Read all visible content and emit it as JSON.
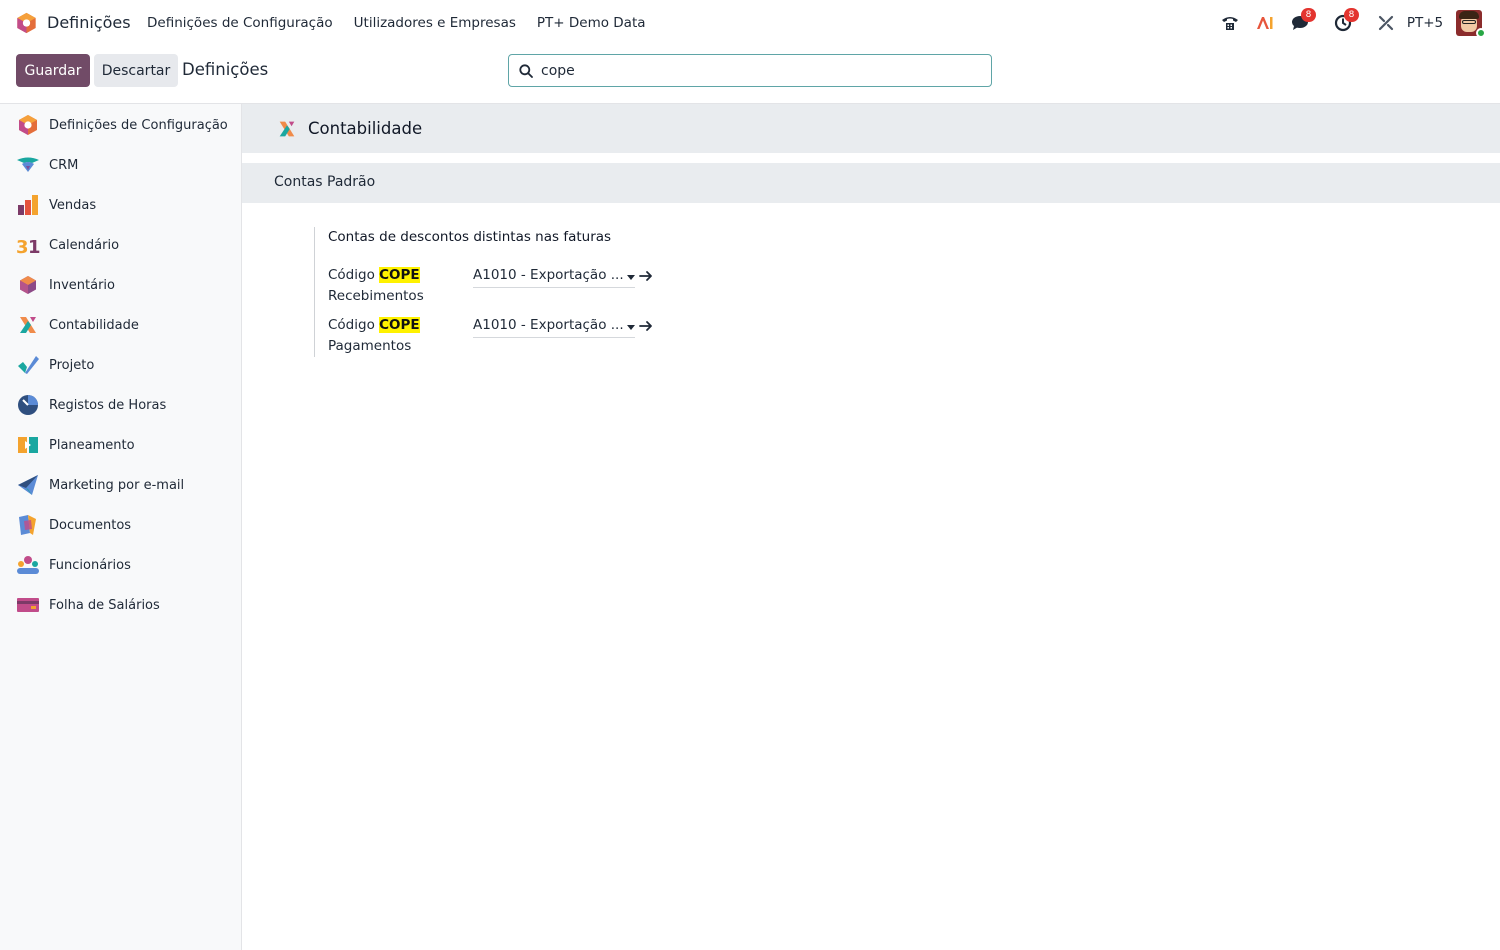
{
  "navbar": {
    "app_name": "Definições",
    "menu": [
      "Definições de Configuração",
      "Utilizadores e Empresas",
      "PT+ Demo Data"
    ],
    "messages_count": "8",
    "activities_count": "8",
    "company": "PT+5"
  },
  "control": {
    "save_label": "Guardar",
    "discard_label": "Descartar",
    "breadcrumb": "Definições"
  },
  "search": {
    "value": "cope"
  },
  "sidebar": {
    "items": [
      {
        "label": "Definições de Configuração",
        "icon": "settings-app-icon"
      },
      {
        "label": "CRM",
        "icon": "crm-app-icon"
      },
      {
        "label": "Vendas",
        "icon": "sales-app-icon"
      },
      {
        "label": "Calendário",
        "icon": "calendar-app-icon"
      },
      {
        "label": "Inventário",
        "icon": "inventory-app-icon"
      },
      {
        "label": "Contabilidade",
        "icon": "accounting-app-icon"
      },
      {
        "label": "Projeto",
        "icon": "project-app-icon"
      },
      {
        "label": "Registos de Horas",
        "icon": "timesheets-app-icon"
      },
      {
        "label": "Planeamento",
        "icon": "planning-app-icon"
      },
      {
        "label": "Marketing por e-mail",
        "icon": "email-marketing-app-icon"
      },
      {
        "label": "Documentos",
        "icon": "documents-app-icon"
      },
      {
        "label": "Funcionários",
        "icon": "employees-app-icon"
      },
      {
        "label": "Folha de Salários",
        "icon": "payroll-app-icon"
      }
    ]
  },
  "main": {
    "app_title": "Contabilidade",
    "section_title": "Contas Padrão",
    "setting_title": "Contas de descontos distintas nas faturas",
    "fields": [
      {
        "label_prefix": "Código ",
        "label_highlight": "COPE",
        "label_suffix": "Recebimentos",
        "value": "A1010 - Exportação ..."
      },
      {
        "label_prefix": "Código ",
        "label_highlight": "COPE",
        "label_suffix": "Pagamentos",
        "value": "A1010 - Exportação ..."
      }
    ]
  },
  "colors": {
    "primary": "#714b67",
    "highlight": "#fff200",
    "badge": "#e3342f"
  }
}
